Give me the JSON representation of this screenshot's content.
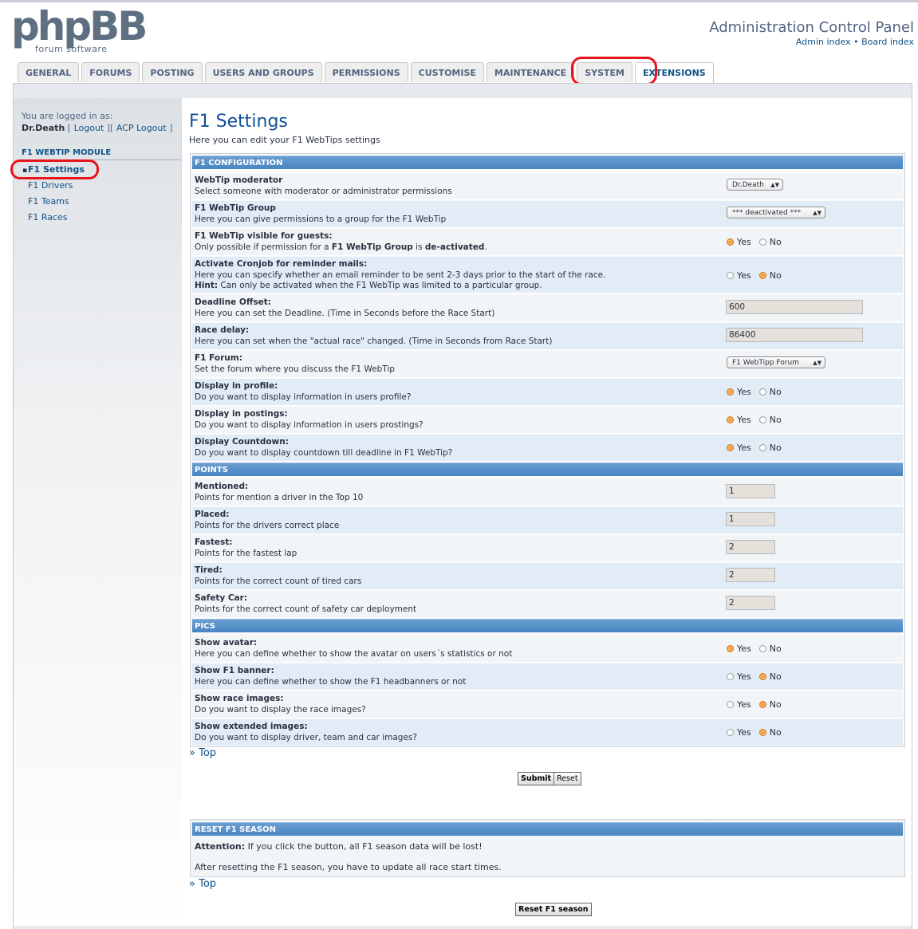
{
  "header": {
    "logo_main": "phpBB",
    "logo_sub": "forum software",
    "title": "Administration Control Panel",
    "admin_index": "Admin index",
    "separator": "•",
    "board_index": "Board index"
  },
  "tabs": [
    {
      "label": "GENERAL"
    },
    {
      "label": "FORUMS"
    },
    {
      "label": "POSTING"
    },
    {
      "label": "USERS AND GROUPS"
    },
    {
      "label": "PERMISSIONS"
    },
    {
      "label": "CUSTOMISE"
    },
    {
      "label": "MAINTENANCE"
    },
    {
      "label": "SYSTEM"
    },
    {
      "label": "EXTENSIONS"
    }
  ],
  "sidebar": {
    "logged_in_label": "You are logged in as:",
    "username": "Dr.Death",
    "logout": "Logout",
    "acp_logout": "ACP Logout",
    "module_heading": "F1 WEBTIP MODULE",
    "items": [
      {
        "label": "F1 Settings"
      },
      {
        "label": "F1 Drivers"
      },
      {
        "label": "F1 Teams"
      },
      {
        "label": "F1 Races"
      }
    ]
  },
  "main": {
    "title": "F1 Settings",
    "description": "Here you can edit your F1 WebTips settings",
    "radio_yes": "Yes",
    "radio_no": "No",
    "sections": {
      "config": "F1 CONFIGURATION",
      "points": "POINTS",
      "pics": "PICS"
    },
    "config_rows": {
      "moderator": {
        "label": "WebTip moderator",
        "desc": "Select someone with moderator or administrator permissions",
        "value": "Dr.Death"
      },
      "group": {
        "label": "F1 WebTip Group",
        "desc": "Here you can give permissions to a group for the F1 WebTip",
        "value": "*** deactivated ***"
      },
      "guests": {
        "label": "F1 WebTip visible for guests:",
        "desc_a": "Only possible if permission for a ",
        "desc_b": "F1 WebTip Group",
        "desc_c": " is ",
        "desc_d": "de-activated",
        "desc_e": "."
      },
      "cron": {
        "label": "Activate Cronjob for reminder mails:",
        "desc": "Here you can specify whether an email reminder to be sent 2-3 days prior to the start of the race.",
        "hint_label": "Hint:",
        "hint": " Can only be activated when the F1 WebTip was limited to a particular group."
      },
      "deadline": {
        "label": "Deadline Offset:",
        "desc": "Here you can set the Deadline. (Time in Seconds before the Race Start)",
        "value": "600"
      },
      "delay": {
        "label": "Race delay:",
        "desc": "Here you can set when the \"actual race\" changed. (Time in Seconds from Race Start)",
        "value": "86400"
      },
      "forum": {
        "label": "F1 Forum:",
        "desc": "Set the forum where you discuss the F1 WebTip",
        "value": "F1 WebTipp Forum"
      },
      "profile": {
        "label": "Display in profile:",
        "desc": "Do you want to display information in users profile?"
      },
      "postings": {
        "label": "Display in postings:",
        "desc": "Do you want to display information in users prostings?"
      },
      "countdown": {
        "label": "Display Countdown:",
        "desc": "Do you want to display countdown till deadline in F1 WebTip?"
      }
    },
    "points_rows": {
      "mentioned": {
        "label": "Mentioned:",
        "desc": "Points for mention a driver in the Top 10",
        "value": "1"
      },
      "placed": {
        "label": "Placed:",
        "desc": "Points for the drivers correct place",
        "value": "1"
      },
      "fastest": {
        "label": "Fastest:",
        "desc": "Points for the fastest lap",
        "value": "2"
      },
      "tired": {
        "label": "Tired:",
        "desc": "Points for the correct count of tired cars",
        "value": "2"
      },
      "safety": {
        "label": "Safety Car:",
        "desc": "Points for the correct count of safety car deployment",
        "value": "2"
      }
    },
    "pics_rows": {
      "avatar": {
        "label": "Show avatar:",
        "desc": "Here you can define whether to show the avatar on users´s statistics or not"
      },
      "banner": {
        "label": "Show F1 banner:",
        "desc": "Here you can define whether to show the F1 headbanners or not"
      },
      "race_images": {
        "label": "Show race images:",
        "desc": "Do you want to display the race images?"
      },
      "extended": {
        "label": "Show extended images:",
        "desc": "Do you want to display driver, team and car images?"
      }
    },
    "top_link": "» Top",
    "submit": "Submit",
    "reset": "Reset"
  },
  "reset_season": {
    "heading": "RESET F1 SEASON",
    "attention_label": "Attention:",
    "attention_text": " If you click the button, all F1 season data will be lost!",
    "after_text": "After resetting the F1 season, you have to update all race start times.",
    "top_link": "» Top",
    "button": "Reset F1 season"
  },
  "colors": {
    "accent": "#105289",
    "section_header": "#4886c3",
    "highlight_ring": "#e5151b",
    "radio_selected": "#f39431"
  },
  "radio_state": {
    "guests": "yes",
    "cron": "no",
    "profile": "yes",
    "postings": "yes",
    "countdown": "yes",
    "avatar": "yes",
    "banner": "no",
    "race_images": "no",
    "extended": "no"
  }
}
